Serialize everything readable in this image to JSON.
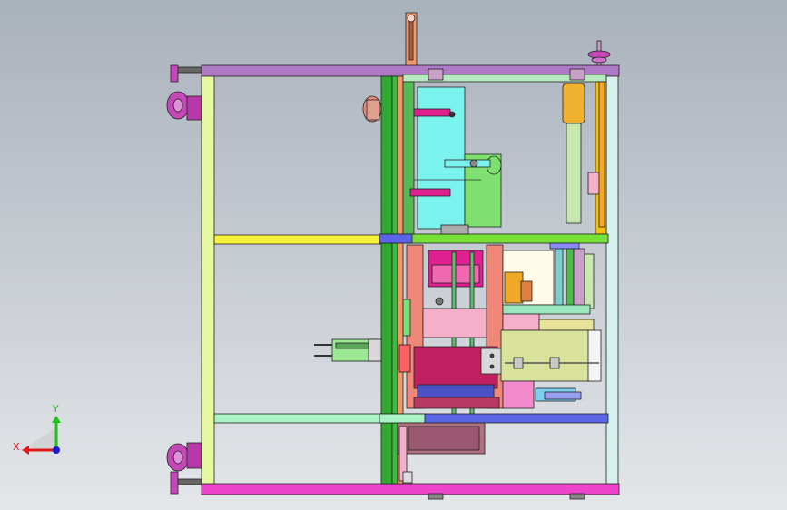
{
  "viewport": {
    "background_top": "#a9b1bb",
    "background_bottom": "#e4e6e9"
  },
  "axes": {
    "x_label": "X",
    "y_label": "Y",
    "x_color": "#e01818",
    "y_color": "#1ec31e",
    "z_color": "#1a1ad0"
  },
  "colors": {
    "frame_top": "#b07ac6",
    "frame_bottom": "#ee44cc",
    "frame_left": "#e6f7a0",
    "frame_right": "#d6f0ee",
    "rail_yellow": "#f6f23a",
    "rail_mint": "#a8f2c4",
    "rail_green": "#2fa92f",
    "column_orange": "#f29860",
    "column_teal": "#64c8c8",
    "cyan_panel": "#7af2ee",
    "green_bracket": "#7ee06e",
    "magenta_block": "#e02090",
    "salmon": "#f0887a",
    "pink": "#f4b0c8",
    "olive_block": "#d8e29a",
    "gold_cylinder": "#f0b030",
    "blue_bar": "#5a64e6",
    "wheel": "#c448b8"
  }
}
